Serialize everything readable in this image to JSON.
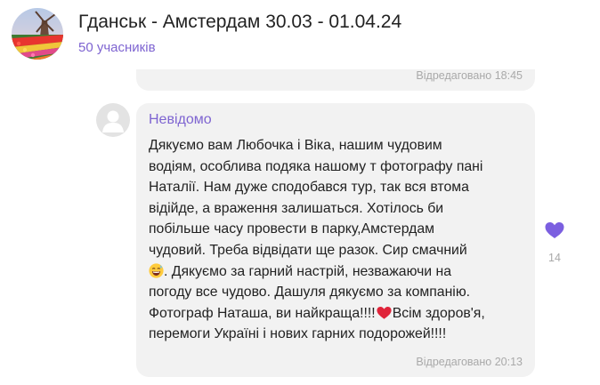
{
  "header": {
    "title": "Гданськ - Амстердам 30.03 - 01.04.24",
    "subtitle": "50 учасників",
    "avatar_icon": "tulip-field-windmill-photo"
  },
  "previous_message": {
    "edited_label": "Відредаговано 18:45"
  },
  "message": {
    "sender": "Невідомо",
    "avatar_icon": "default-user-icon",
    "text_lines": [
      "Дякуємо вам Любочка і Віка, нашим чудовим",
      "водіям, особлива подяка нашому т фотографу пані",
      "Наталії. Нам дуже сподобався тур, так вся втома",
      "відійде, а враження залишаться. Хотілось би",
      "побільше часу провести в парку,Амстердам",
      "чудовий. Треба відвідати ще разок. Сир смачний",
      ". Дякуємо за гарний настрій, незважаючи на",
      "погоду все чудово. Дашуля дякуємо за компанію.",
      "Фотограф Наташа,  ви найкраща!!!!",
      "Всім здоров'я,",
      "перемоги Україні і нових гарних подорожей!!!!"
    ],
    "edited_label": "Відредаговано 20:13",
    "emoji": [
      "grinning-sweat-emoji",
      "red-heart-emoji"
    ]
  },
  "reaction": {
    "icon": "purple-heart-icon",
    "count": "14"
  },
  "colors": {
    "accent": "#7e64d1",
    "bubble": "#f2f2f2",
    "meta_text": "#a9a9a9",
    "heart_purple": "#7b5fe0",
    "heart_red": "#e0243a"
  }
}
